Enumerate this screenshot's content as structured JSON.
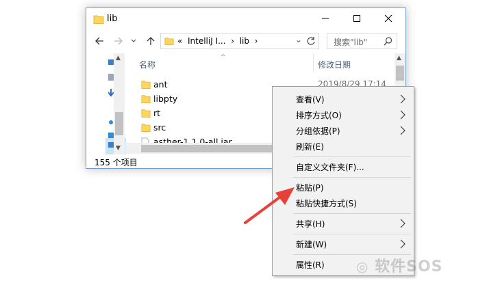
{
  "window": {
    "title": "lib",
    "controls": [
      "minimize-icon",
      "maximize-icon",
      "close-icon"
    ]
  },
  "navbar": {
    "back_icon": "arrow-left-icon",
    "forward_icon": "arrow-right-icon",
    "recent_icon": "chevron-down-icon",
    "up_icon": "arrow-up-icon",
    "address": {
      "overflow": "«",
      "segments": [
        "IntelliJ I...",
        "lib"
      ]
    },
    "refresh_icon": "refresh-icon",
    "search": {
      "placeholder": "搜索\"lib\""
    }
  },
  "columns": {
    "name": "名称",
    "date": "修改日期"
  },
  "files": [
    {
      "name": "ant",
      "kind": "folder",
      "date": "2019/8/29 17:14"
    },
    {
      "name": "libpty",
      "kind": "folder"
    },
    {
      "name": "rt",
      "kind": "folder"
    },
    {
      "name": "src",
      "kind": "folder"
    },
    {
      "name": "asther-1.1.0-all.jar",
      "kind": "file"
    }
  ],
  "status": {
    "count_text": "155 个项目"
  },
  "context_menu": {
    "groups": [
      [
        {
          "label": "查看(V)",
          "submenu": true
        },
        {
          "label": "排序方式(O)",
          "submenu": true
        },
        {
          "label": "分组依据(P)",
          "submenu": true
        },
        {
          "label": "刷新(E)",
          "submenu": false
        }
      ],
      [
        {
          "label": "自定义文件夹(F)...",
          "submenu": false
        }
      ],
      [
        {
          "label": "粘贴(P)",
          "submenu": false
        },
        {
          "label": "粘贴快捷方式(S)",
          "submenu": false
        }
      ],
      [
        {
          "label": "共享(H)",
          "submenu": true
        }
      ],
      [
        {
          "label": "新建(W)",
          "submenu": true
        }
      ],
      [
        {
          "label": "属性(R)",
          "submenu": false
        }
      ]
    ]
  },
  "annotation": {
    "arrow_color": "#e8413a"
  },
  "watermark": {
    "text": "软件SOS"
  },
  "colors": {
    "folder": "#ffd55c",
    "window_border": "#6a9ed6"
  }
}
